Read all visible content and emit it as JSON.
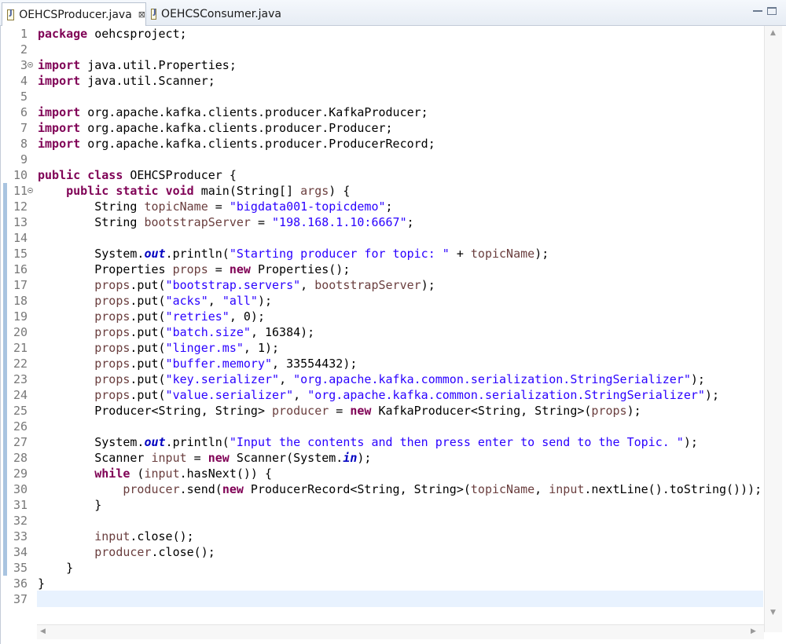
{
  "tabs": [
    {
      "label": "OEHCSProducer.java",
      "active": true,
      "icon": "java-file-icon"
    },
    {
      "label": "OEHCSConsumer.java",
      "active": false,
      "icon": "java-file-icon"
    }
  ],
  "tab_close_glyph": "⊠",
  "colors": {
    "keyword": "#7f0055",
    "string": "#2a00ff",
    "local_variable": "#6a3e3e",
    "static_field": "#0000c0",
    "line_number": "#787878",
    "current_line": "#e8f2fe",
    "change_bar": "#a9c4e0"
  },
  "editor": {
    "current_line": 37,
    "folding_markers": [
      3,
      11
    ],
    "changed_line_range": [
      11,
      35
    ],
    "lines": [
      {
        "n": "1",
        "tokens": [
          {
            "t": "package",
            "c": "kw"
          },
          {
            "t": " oehcsproject;"
          }
        ]
      },
      {
        "n": "2",
        "tokens": []
      },
      {
        "n": "3",
        "tokens": [
          {
            "t": "import",
            "c": "kw"
          },
          {
            "t": " java.util.Properties;"
          }
        ]
      },
      {
        "n": "4",
        "tokens": [
          {
            "t": "import",
            "c": "kw"
          },
          {
            "t": " java.util.Scanner;"
          }
        ]
      },
      {
        "n": "5",
        "tokens": []
      },
      {
        "n": "6",
        "tokens": [
          {
            "t": "import",
            "c": "kw"
          },
          {
            "t": " org.apache.kafka.clients.producer.KafkaProducer;"
          }
        ]
      },
      {
        "n": "7",
        "tokens": [
          {
            "t": "import",
            "c": "kw"
          },
          {
            "t": " org.apache.kafka.clients.producer.Producer;"
          }
        ]
      },
      {
        "n": "8",
        "tokens": [
          {
            "t": "import",
            "c": "kw"
          },
          {
            "t": " org.apache.kafka.clients.producer.ProducerRecord;"
          }
        ]
      },
      {
        "n": "9",
        "tokens": []
      },
      {
        "n": "10",
        "tokens": [
          {
            "t": "public",
            "c": "kw"
          },
          {
            "t": " "
          },
          {
            "t": "class",
            "c": "kw"
          },
          {
            "t": " OEHCSProducer {"
          }
        ]
      },
      {
        "n": "11",
        "tokens": [
          {
            "t": "    "
          },
          {
            "t": "public",
            "c": "kw"
          },
          {
            "t": " "
          },
          {
            "t": "static",
            "c": "kw"
          },
          {
            "t": " "
          },
          {
            "t": "void",
            "c": "kw"
          },
          {
            "t": " main(String[] "
          },
          {
            "t": "args",
            "c": "var"
          },
          {
            "t": ") {"
          }
        ]
      },
      {
        "n": "12",
        "tokens": [
          {
            "t": "        String "
          },
          {
            "t": "topicName",
            "c": "var"
          },
          {
            "t": " = "
          },
          {
            "t": "\"bigdata001-topicdemo\"",
            "c": "str"
          },
          {
            "t": ";"
          }
        ]
      },
      {
        "n": "13",
        "tokens": [
          {
            "t": "        String "
          },
          {
            "t": "bootstrapServer",
            "c": "var"
          },
          {
            "t": " = "
          },
          {
            "t": "\"198.168.1.10:6667\"",
            "c": "str"
          },
          {
            "t": ";"
          }
        ]
      },
      {
        "n": "14",
        "tokens": []
      },
      {
        "n": "15",
        "tokens": [
          {
            "t": "        System."
          },
          {
            "t": "out",
            "c": "fld"
          },
          {
            "t": ".println("
          },
          {
            "t": "\"Starting producer for topic: \"",
            "c": "str"
          },
          {
            "t": " + "
          },
          {
            "t": "topicName",
            "c": "var"
          },
          {
            "t": ");"
          }
        ]
      },
      {
        "n": "16",
        "tokens": [
          {
            "t": "        Properties "
          },
          {
            "t": "props",
            "c": "var"
          },
          {
            "t": " = "
          },
          {
            "t": "new",
            "c": "kw"
          },
          {
            "t": " Properties();"
          }
        ]
      },
      {
        "n": "17",
        "tokens": [
          {
            "t": "        "
          },
          {
            "t": "props",
            "c": "var"
          },
          {
            "t": ".put("
          },
          {
            "t": "\"bootstrap.servers\"",
            "c": "str"
          },
          {
            "t": ", "
          },
          {
            "t": "bootstrapServer",
            "c": "var"
          },
          {
            "t": ");"
          }
        ]
      },
      {
        "n": "18",
        "tokens": [
          {
            "t": "        "
          },
          {
            "t": "props",
            "c": "var"
          },
          {
            "t": ".put("
          },
          {
            "t": "\"acks\"",
            "c": "str"
          },
          {
            "t": ", "
          },
          {
            "t": "\"all\"",
            "c": "str"
          },
          {
            "t": ");"
          }
        ]
      },
      {
        "n": "19",
        "tokens": [
          {
            "t": "        "
          },
          {
            "t": "props",
            "c": "var"
          },
          {
            "t": ".put("
          },
          {
            "t": "\"retries\"",
            "c": "str"
          },
          {
            "t": ", 0);"
          }
        ]
      },
      {
        "n": "20",
        "tokens": [
          {
            "t": "        "
          },
          {
            "t": "props",
            "c": "var"
          },
          {
            "t": ".put("
          },
          {
            "t": "\"batch.size\"",
            "c": "str"
          },
          {
            "t": ", 16384);"
          }
        ]
      },
      {
        "n": "21",
        "tokens": [
          {
            "t": "        "
          },
          {
            "t": "props",
            "c": "var"
          },
          {
            "t": ".put("
          },
          {
            "t": "\"linger.ms\"",
            "c": "str"
          },
          {
            "t": ", 1);"
          }
        ]
      },
      {
        "n": "22",
        "tokens": [
          {
            "t": "        "
          },
          {
            "t": "props",
            "c": "var"
          },
          {
            "t": ".put("
          },
          {
            "t": "\"buffer.memory\"",
            "c": "str"
          },
          {
            "t": ", 33554432);"
          }
        ]
      },
      {
        "n": "23",
        "tokens": [
          {
            "t": "        "
          },
          {
            "t": "props",
            "c": "var"
          },
          {
            "t": ".put("
          },
          {
            "t": "\"key.serializer\"",
            "c": "str"
          },
          {
            "t": ", "
          },
          {
            "t": "\"org.apache.kafka.common.serialization.StringSerializer\"",
            "c": "str"
          },
          {
            "t": ");"
          }
        ]
      },
      {
        "n": "24",
        "tokens": [
          {
            "t": "        "
          },
          {
            "t": "props",
            "c": "var"
          },
          {
            "t": ".put("
          },
          {
            "t": "\"value.serializer\"",
            "c": "str"
          },
          {
            "t": ", "
          },
          {
            "t": "\"org.apache.kafka.common.serialization.StringSerializer\"",
            "c": "str"
          },
          {
            "t": ");"
          }
        ]
      },
      {
        "n": "25",
        "tokens": [
          {
            "t": "        Producer<String, String> "
          },
          {
            "t": "producer",
            "c": "var"
          },
          {
            "t": " = "
          },
          {
            "t": "new",
            "c": "kw"
          },
          {
            "t": " KafkaProducer<String, String>("
          },
          {
            "t": "props",
            "c": "var"
          },
          {
            "t": ");"
          }
        ]
      },
      {
        "n": "26",
        "tokens": []
      },
      {
        "n": "27",
        "tokens": [
          {
            "t": "        System."
          },
          {
            "t": "out",
            "c": "fld"
          },
          {
            "t": ".println("
          },
          {
            "t": "\"Input the contents and then press enter to send to the Topic. \"",
            "c": "str"
          },
          {
            "t": ");"
          }
        ]
      },
      {
        "n": "28",
        "tokens": [
          {
            "t": "        Scanner "
          },
          {
            "t": "input",
            "c": "var"
          },
          {
            "t": " = "
          },
          {
            "t": "new",
            "c": "kw"
          },
          {
            "t": " Scanner(System."
          },
          {
            "t": "in",
            "c": "fld"
          },
          {
            "t": ");"
          }
        ]
      },
      {
        "n": "29",
        "tokens": [
          {
            "t": "        "
          },
          {
            "t": "while",
            "c": "kw"
          },
          {
            "t": " ("
          },
          {
            "t": "input",
            "c": "var"
          },
          {
            "t": ".hasNext()) {"
          }
        ]
      },
      {
        "n": "30",
        "tokens": [
          {
            "t": "            "
          },
          {
            "t": "producer",
            "c": "var"
          },
          {
            "t": ".send("
          },
          {
            "t": "new",
            "c": "kw"
          },
          {
            "t": " ProducerRecord<String, String>("
          },
          {
            "t": "topicName",
            "c": "var"
          },
          {
            "t": ", "
          },
          {
            "t": "input",
            "c": "var"
          },
          {
            "t": ".nextLine().toString()));"
          }
        ]
      },
      {
        "n": "31",
        "tokens": [
          {
            "t": "        }"
          }
        ]
      },
      {
        "n": "32",
        "tokens": []
      },
      {
        "n": "33",
        "tokens": [
          {
            "t": "        "
          },
          {
            "t": "input",
            "c": "var"
          },
          {
            "t": ".close();"
          }
        ]
      },
      {
        "n": "34",
        "tokens": [
          {
            "t": "        "
          },
          {
            "t": "producer",
            "c": "var"
          },
          {
            "t": ".close();"
          }
        ]
      },
      {
        "n": "35",
        "tokens": [
          {
            "t": "    }"
          }
        ]
      },
      {
        "n": "36",
        "tokens": [
          {
            "t": "}"
          }
        ]
      },
      {
        "n": "37",
        "tokens": []
      }
    ]
  }
}
